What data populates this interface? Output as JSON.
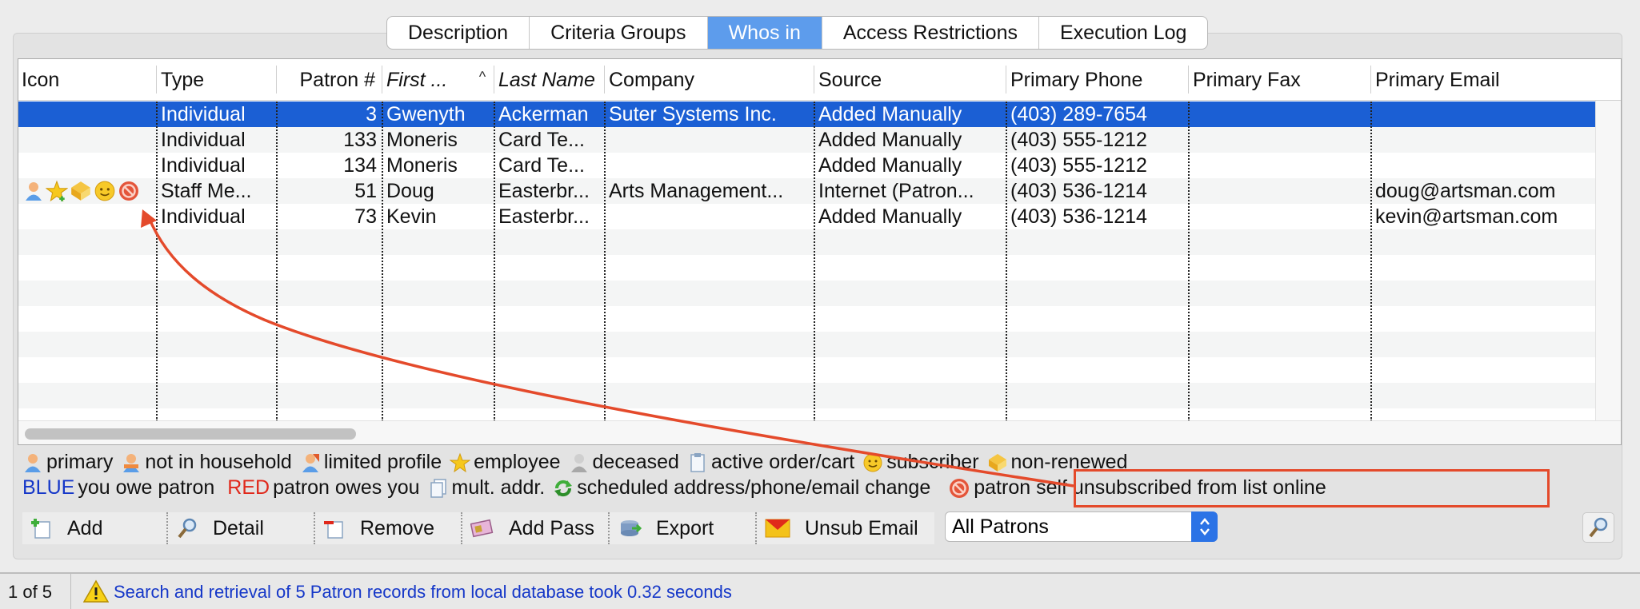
{
  "tabs": [
    {
      "label": "Description",
      "active": false
    },
    {
      "label": "Criteria Groups",
      "active": false
    },
    {
      "label": "Whos in",
      "active": true
    },
    {
      "label": "Access Restrictions",
      "active": false
    },
    {
      "label": "Execution Log",
      "active": false
    }
  ],
  "table": {
    "columns": [
      "Icon",
      "Type",
      "Patron #",
      "First ...",
      "Last Name",
      "Company",
      "Source",
      "Primary Phone",
      "Primary Fax",
      "Primary Email"
    ],
    "sort_indicator": "^",
    "rows": [
      {
        "icons": [],
        "type": "Individual",
        "patron": "3",
        "first": "Gwenyth",
        "last": "Ackerman",
        "company": "Suter Systems Inc.",
        "source": "Added Manually",
        "phone": "(403) 289-7654",
        "fax": "",
        "email": ""
      },
      {
        "icons": [],
        "type": "Individual",
        "patron": "133",
        "first": "Moneris",
        "last": "Card Te...",
        "company": "",
        "source": "Added Manually",
        "phone": "(403) 555-1212",
        "fax": "",
        "email": ""
      },
      {
        "icons": [],
        "type": "Individual",
        "patron": "134",
        "first": "Moneris",
        "last": "Card Te...",
        "company": "",
        "source": "Added Manually",
        "phone": "(403) 555-1212",
        "fax": "",
        "email": ""
      },
      {
        "icons": [
          "primary-icon",
          "employee-icon",
          "non-renewed-icon",
          "subscriber-icon",
          "unsubscribed-icon"
        ],
        "type": "Staff Me...",
        "patron": "51",
        "first": "Doug",
        "last": "Easterbr...",
        "company": "Arts Management...",
        "source": "Internet (Patron...",
        "phone": "(403) 536-1214",
        "fax": "",
        "email": "doug@artsman.com"
      },
      {
        "icons": [],
        "type": "Individual",
        "patron": "73",
        "first": "Kevin",
        "last": "Easterbr...",
        "company": "",
        "source": "Added Manually",
        "phone": "(403) 536-1214",
        "fax": "",
        "email": "kevin@artsman.com"
      }
    ],
    "selected_row": 0
  },
  "legend": {
    "line1": [
      {
        "icon": "primary-icon",
        "label": "primary"
      },
      {
        "icon": "not-in-household-icon",
        "label": "not in household"
      },
      {
        "icon": "limited-profile-icon",
        "label": "limited profile"
      },
      {
        "icon": "employee-icon",
        "label": "employee"
      },
      {
        "icon": "deceased-icon",
        "label": "deceased"
      },
      {
        "icon": "active-order-icon",
        "label": "active order/cart"
      },
      {
        "icon": "subscriber-icon",
        "label": "subscriber"
      },
      {
        "icon": "non-renewed-icon",
        "label": "non-renewed"
      }
    ],
    "blue_word": "BLUE",
    "blue_text": "you owe patron",
    "red_word": "RED",
    "red_text": "patron owes you",
    "mult_addr": "mult. addr.",
    "scheduled_change": "scheduled address/phone/email change",
    "unsubscribed": "patron self unsubscribed from list online"
  },
  "toolbar": {
    "add": "Add",
    "detail": "Detail",
    "remove": "Remove",
    "add_pass": "Add Pass",
    "export": "Export",
    "unsub_email": "Unsub Email",
    "filter_value": "All Patrons"
  },
  "status": {
    "count": "1 of 5",
    "message": "Search and retrieval of 5 Patron records from local database took 0.32 seconds"
  },
  "colors": {
    "selection": "#1b5fd4",
    "tab_active": "#5d9cec",
    "annotation": "#e44a2b",
    "blue_legend": "#1537c8",
    "red_legend": "#e0281b"
  }
}
